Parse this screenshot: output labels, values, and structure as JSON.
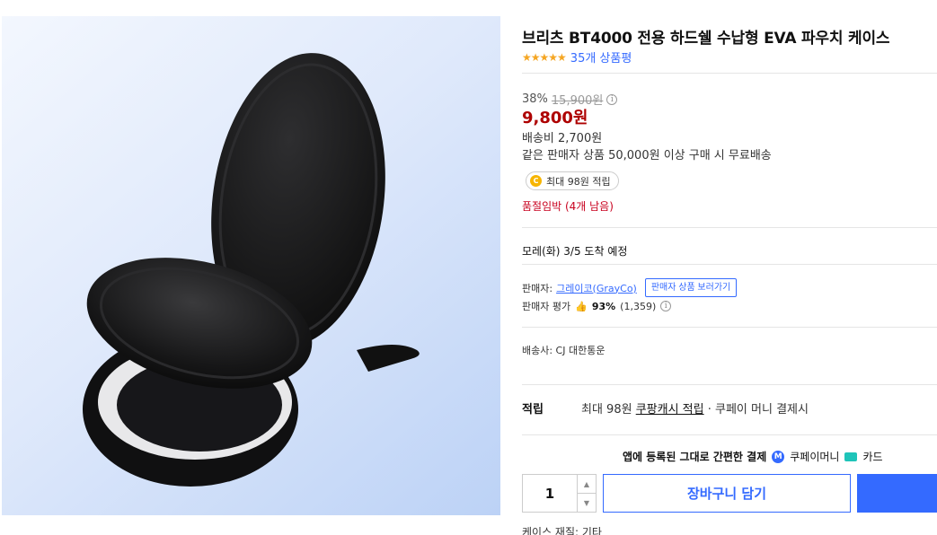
{
  "product": {
    "title": "브리츠 BT4000 전용 하드쉘 수납형 EVA 파우치 케이스",
    "rating_stars": 4.5,
    "review_count_label": "35개 상품평"
  },
  "price": {
    "discount_rate": "38%",
    "original": "15,900원",
    "info_icon_glyph": "i",
    "current": "9,800원"
  },
  "shipping": {
    "fee": "배송비 2,700원",
    "free_condition": "같은 판매자 상품 50,000원 이상 구매 시 무료배송"
  },
  "reward": {
    "coin_glyph": "C",
    "label": "최대 98원 적립"
  },
  "stock_notice": "품절임박 (4개 남음)",
  "delivery_estimate": "모레(화) 3/5 도착 예정",
  "seller": {
    "label": "판매자:",
    "name": "그레이코(GrayCo)",
    "view_products_button": "판매자 상품 보러가기",
    "eval_label": "판매자 평가",
    "eval_percent": "93%",
    "eval_count": "(1,359)"
  },
  "carrier": "배송사: CJ 대한통운",
  "points": {
    "label": "적립",
    "prefix": "최대 98원",
    "link": "쿠팡캐시 적립",
    "suffix": "· 쿠페이 머니 결제시"
  },
  "payment_banner": {
    "text": "앱에 등록된 그대로 간편한 결제",
    "coupay_glyph": "M",
    "coupay_money": "쿠페이머니",
    "card": "카드"
  },
  "purchase": {
    "quantity": "1",
    "add_to_cart": "장바구니 담기"
  },
  "spec_first": "케이스 재질: 기타",
  "colors": {
    "accent": "#346aff",
    "price": "#ae0000",
    "stock": "#c8001e",
    "star": "#f5a623"
  },
  "icons": {
    "star": "star-icon",
    "info": "info-circle-icon",
    "coin": "coin-icon",
    "thumb": "thumbs-up-icon",
    "coupay": "coupay-icon",
    "card": "card-icon"
  }
}
